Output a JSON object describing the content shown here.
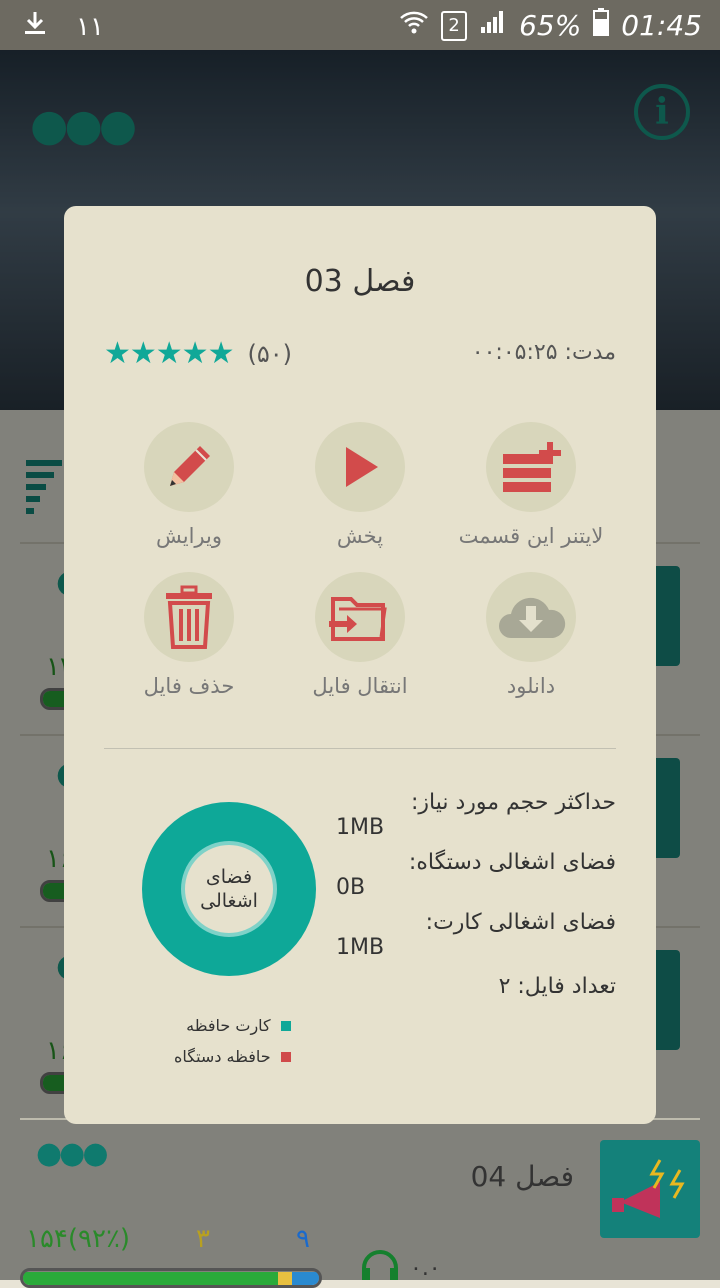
{
  "status": {
    "left_icons": [
      "download-icon",
      "notification-icon"
    ],
    "notification_text": "۱۱",
    "sim_badge": "2",
    "battery": "65%",
    "time": "01:45"
  },
  "background": {
    "rows": [
      {
        "num": "۱۳۰",
        "bar": 0.95
      },
      {
        "num": "۱۶۸",
        "bar": 0.95
      },
      {
        "num": "۱۶۹",
        "bar": 0.95
      }
    ],
    "bottom": {
      "title": "فصل 04",
      "stat_left": "۱۵۴(۹۲٪)",
      "stat_mid": "۳",
      "stat_right": "۹",
      "headphone_value": "۰.۰"
    }
  },
  "dialog": {
    "title": "فصل 03",
    "duration_label": "مدت:",
    "duration_value": "۰۰:۰۵:۲۵",
    "rating_count": "(۵۰)",
    "rating": 5,
    "actions": [
      {
        "label": "ویرایش",
        "icon": "pencil-icon"
      },
      {
        "label": "پخش",
        "icon": "play-icon"
      },
      {
        "label": "لایتنر این قسمت",
        "icon": "add-list-icon"
      },
      {
        "label": "حذف فایل",
        "icon": "trash-icon"
      },
      {
        "label": "انتقال فایل",
        "icon": "move-folder-icon"
      },
      {
        "label": "دانلود",
        "icon": "cloud-download-icon"
      }
    ],
    "stats": {
      "max_size_label": "حداکثر حجم مورد نیاز:",
      "max_size_value": "1MB",
      "device_label": "فضای اشغالی دستگاه:",
      "device_value": "0B",
      "card_label": "فضای اشغالی کارت:",
      "card_value": "1MB",
      "file_count": "تعداد فایل: ۲"
    },
    "donut": {
      "label": "فضای اشغالی",
      "card_fraction": 1.0,
      "device_fraction": 0.0
    },
    "legend": [
      {
        "label": "کارت حافظه",
        "color": "#10a898"
      },
      {
        "label": "حافظه دستگاه",
        "color": "#d04a4a"
      }
    ]
  }
}
